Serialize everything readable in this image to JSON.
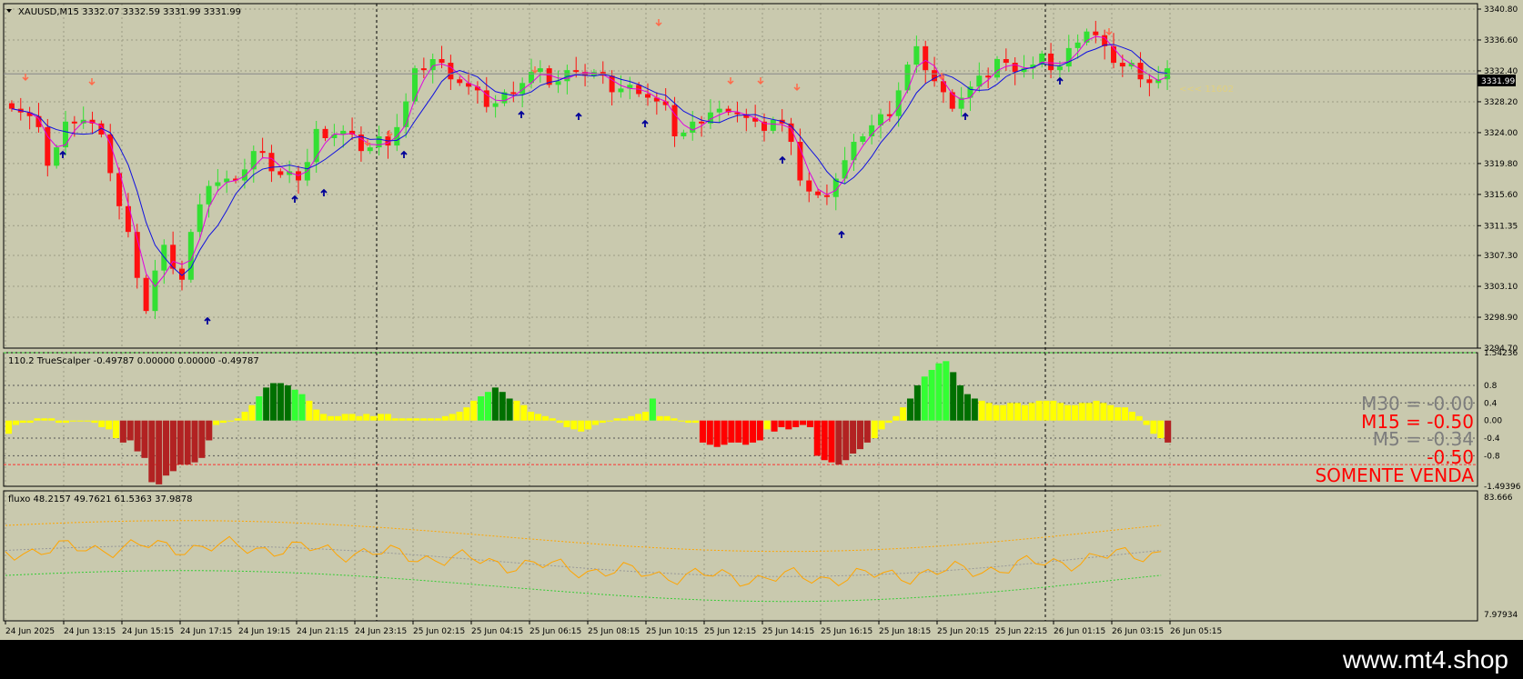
{
  "colors": {
    "background": "#c9c9ae",
    "grid": "#9a9a84",
    "frame": "#000000",
    "bull": "#33e033",
    "bear": "#ff1010",
    "ma_fast": "#e000e0",
    "ma_slow": "#1010e0",
    "sell_arrow": "#ff6a4a",
    "buy_arrow": "#000099",
    "histo_yellow": "#ffff00",
    "histo_lime": "#33ff33",
    "histo_green": "#007000",
    "histo_red": "#ff0000",
    "histo_darkred": "#b22222",
    "fluxo_line": "#ffa500",
    "fluxo_band_top": "#ffa500",
    "fluxo_band_bottom": "#33cc33",
    "fluxo_mid": "#999999",
    "label_gray": "#7d7d7d",
    "label_red": "#ff0000"
  },
  "main": {
    "title": "XAUUSD,M15  3332.07 3332.59 3331.99 3331.99",
    "price_ticks": [
      "3340.80",
      "3336.60",
      "3332.40",
      "3328.20",
      "3324.00",
      "3319.80",
      "3315.60",
      "3311.35",
      "3307.30",
      "3303.10",
      "3298.90",
      "3294.70"
    ],
    "current_price": "3331.99",
    "annotation": "<<< 11602"
  },
  "indicator": {
    "title": "110.2 TrueScalper -0.49787 0.00000 0.00000 -0.49787",
    "y_ticks": [
      "1.54236",
      "0.8",
      "0.4",
      "0.00",
      "-0.4",
      "-0.8",
      "-1.49396"
    ],
    "labels": [
      {
        "text": "M30 = -0.00",
        "color": "#7d7d7d"
      },
      {
        "text": "M15 = -0.50",
        "color": "#ff0000"
      },
      {
        "text": "M5 = -0.34",
        "color": "#7d7d7d"
      },
      {
        "text": "-0.50",
        "color": "#ff0000"
      },
      {
        "text": "SOMENTE VENDA",
        "color": "#ff0000"
      }
    ]
  },
  "fluxo": {
    "title": "fluxo 48.2157 49.7621 61.5363 37.9878",
    "y_ticks": [
      "83.666",
      "7.97934"
    ]
  },
  "x_axis_labels": [
    "24 Jun 2025",
    "24 Jun 13:15",
    "24 Jun 15:15",
    "24 Jun 17:15",
    "24 Jun 19:15",
    "24 Jun 21:15",
    "24 Jun 23:15",
    "25 Jun 02:15",
    "25 Jun 04:15",
    "25 Jun 06:15",
    "25 Jun 08:15",
    "25 Jun 10:15",
    "25 Jun 12:15",
    "25 Jun 14:15",
    "25 Jun 16:15",
    "25 Jun 18:15",
    "25 Jun 20:15",
    "25 Jun 22:15",
    "26 Jun 01:15",
    "26 Jun 03:15",
    "26 Jun 05:15"
  ],
  "watermark": "www.mt4.shop",
  "chart_data": {
    "type": "candlestick",
    "symbol": "XAUUSD",
    "timeframe": "M15",
    "ylim": [
      3294.7,
      3340.8
    ],
    "close_path": [
      3328,
      3327,
      3326,
      3324,
      3320,
      3322,
      3325,
      3326,
      3326,
      3325,
      3323,
      3319,
      3314,
      3310,
      3305,
      3300,
      3305,
      3308,
      3306,
      3304,
      3310,
      3315,
      3317,
      3317,
      3317,
      3318,
      3319,
      3321,
      3322,
      3319,
      3318,
      3318,
      3318,
      3320,
      3324,
      3324,
      3324,
      3324,
      3323,
      3322,
      3322,
      3323,
      3323,
      3325,
      3328,
      3332,
      3333,
      3334,
      3333,
      3332,
      3331,
      3330,
      3329,
      3328,
      3328,
      3329,
      3330,
      3331,
      3332,
      3332,
      3331,
      3331,
      3332,
      3333,
      3332,
      3332,
      3331,
      3330,
      3330,
      3330,
      3330,
      3329,
      3328,
      3327,
      3324,
      3324,
      3325,
      3326,
      3327,
      3327,
      3326,
      3327,
      3326,
      3325,
      3325,
      3326,
      3325,
      3322,
      3318,
      3316,
      3315,
      3316,
      3318,
      3320,
      3322,
      3324,
      3325,
      3326,
      3327,
      3330,
      3333,
      3335,
      3333,
      3331,
      3329,
      3328,
      3329,
      3330,
      3331,
      3332,
      3334,
      3333,
      3333,
      3333,
      3333,
      3334,
      3333,
      3333,
      3335,
      3337,
      3338,
      3337,
      3335,
      3334,
      3333,
      3333,
      3332,
      3331,
      3331,
      3332
    ],
    "ma_fast": "pink moving average",
    "ma_slow": "blue moving average",
    "indicator_TrueScalper": {
      "values": [
        -0.3,
        -0.1,
        -0.05,
        -0.05,
        0.05,
        0.05,
        0.05,
        -0.05,
        -0.05,
        0.0,
        0.0,
        0.0,
        -0.05,
        -0.15,
        -0.2,
        -0.4,
        -0.5,
        -0.45,
        -0.7,
        -0.85,
        -1.4,
        -1.45,
        -1.25,
        -1.15,
        -1.0,
        -1.0,
        -0.95,
        -0.85,
        -0.45,
        -0.1,
        -0.05,
        0.0,
        0.05,
        0.2,
        0.35,
        0.55,
        0.75,
        0.85,
        0.85,
        0.8,
        0.7,
        0.6,
        0.45,
        0.25,
        0.15,
        0.1,
        0.1,
        0.15,
        0.15,
        0.1,
        0.15,
        0.1,
        0.15,
        0.15,
        0.05,
        0.05,
        0.05,
        0.05,
        0.05,
        0.05,
        0.05,
        0.1,
        0.15,
        0.2,
        0.3,
        0.45,
        0.55,
        0.65,
        0.75,
        0.65,
        0.5,
        0.45,
        0.35,
        0.2,
        0.15,
        0.1,
        0.05,
        -0.05,
        -0.15,
        -0.2,
        -0.25,
        -0.2,
        -0.1,
        -0.05,
        0.0,
        0.05,
        0.05,
        0.1,
        0.15,
        0.2,
        0.5,
        0.1,
        0.1,
        0.05,
        0.0,
        -0.05,
        -0.05,
        -0.5,
        -0.55,
        -0.6,
        -0.55,
        -0.5,
        -0.5,
        -0.55,
        -0.5,
        -0.45,
        -0.2,
        -0.25,
        -0.15,
        -0.2,
        -0.15,
        -0.1,
        -0.15,
        -0.8,
        -0.9,
        -0.95,
        -1.0,
        -0.9,
        -0.75,
        -0.65,
        -0.5,
        -0.4,
        -0.2,
        -0.05,
        0.1,
        0.3,
        0.5,
        0.8,
        1.0,
        1.15,
        1.3,
        1.35,
        1.1,
        0.8,
        0.6,
        0.5,
        0.45,
        0.4,
        0.35,
        0.35,
        0.4,
        0.4,
        0.35,
        0.4,
        0.45,
        0.45,
        0.45,
        0.4,
        0.35,
        0.35,
        0.4,
        0.4,
        0.45,
        0.4,
        0.35,
        0.3,
        0.3,
        0.2,
        0.1,
        -0.1,
        -0.3,
        -0.4,
        -0.5
      ]
    },
    "indicator_fluxo": {
      "current": [
        48.2157,
        49.7621,
        61.5363,
        37.9878
      ]
    }
  }
}
